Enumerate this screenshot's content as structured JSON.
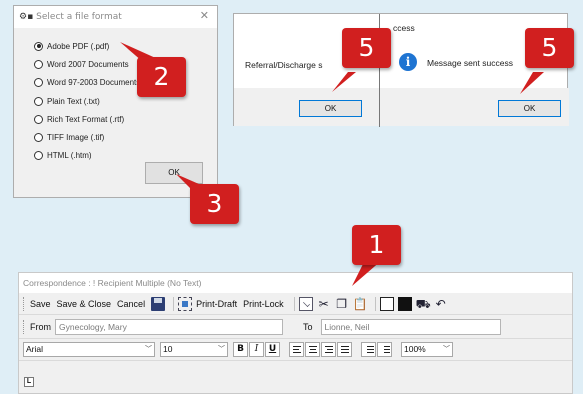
{
  "format_dialog": {
    "title": "Select a file format",
    "close_glyph": "✕",
    "options": [
      {
        "label": "Adobe PDF (.pdf)",
        "checked": true
      },
      {
        "label": "Word 2007 Documents",
        "checked": false
      },
      {
        "label": "Word 97-2003 Documents",
        "checked": false
      },
      {
        "label": "Plain Text (.txt)",
        "checked": false
      },
      {
        "label": "Rich Text Format (.rtf)",
        "checked": false
      },
      {
        "label": "TIFF Image (.tif)",
        "checked": false
      },
      {
        "label": "HTML (.htm)",
        "checked": false
      }
    ],
    "ok_label": "OK"
  },
  "message_dialogs": {
    "title_fragment": "ccess",
    "left_message": "Referral/Discharge s",
    "right_message": "Message sent success",
    "info_glyph": "i",
    "left_ok_label": "OK",
    "right_ok_label": "OK"
  },
  "badges": {
    "step1": "1",
    "step2": "2",
    "step3": "3",
    "step5_left": "5",
    "step5_right": "5",
    "color": "#d11f1f"
  },
  "correspondence": {
    "title": "Correspondence : ! Recipient Multiple (No Text)",
    "toolbar": {
      "save": "Save",
      "save_close": "Save & Close",
      "cancel": "Cancel",
      "print_draft": "Print-Draft",
      "print_lock": "Print-Lock"
    },
    "fields": {
      "from_label": "From",
      "from_value": "Gynecology, Mary",
      "to_label": "To",
      "to_value": "Lionne, Neil"
    },
    "format": {
      "font": "Arial",
      "size": "10",
      "bold": "B",
      "italic": "I",
      "underline": "U",
      "zoom": "100%"
    },
    "ruler_button": "L"
  }
}
